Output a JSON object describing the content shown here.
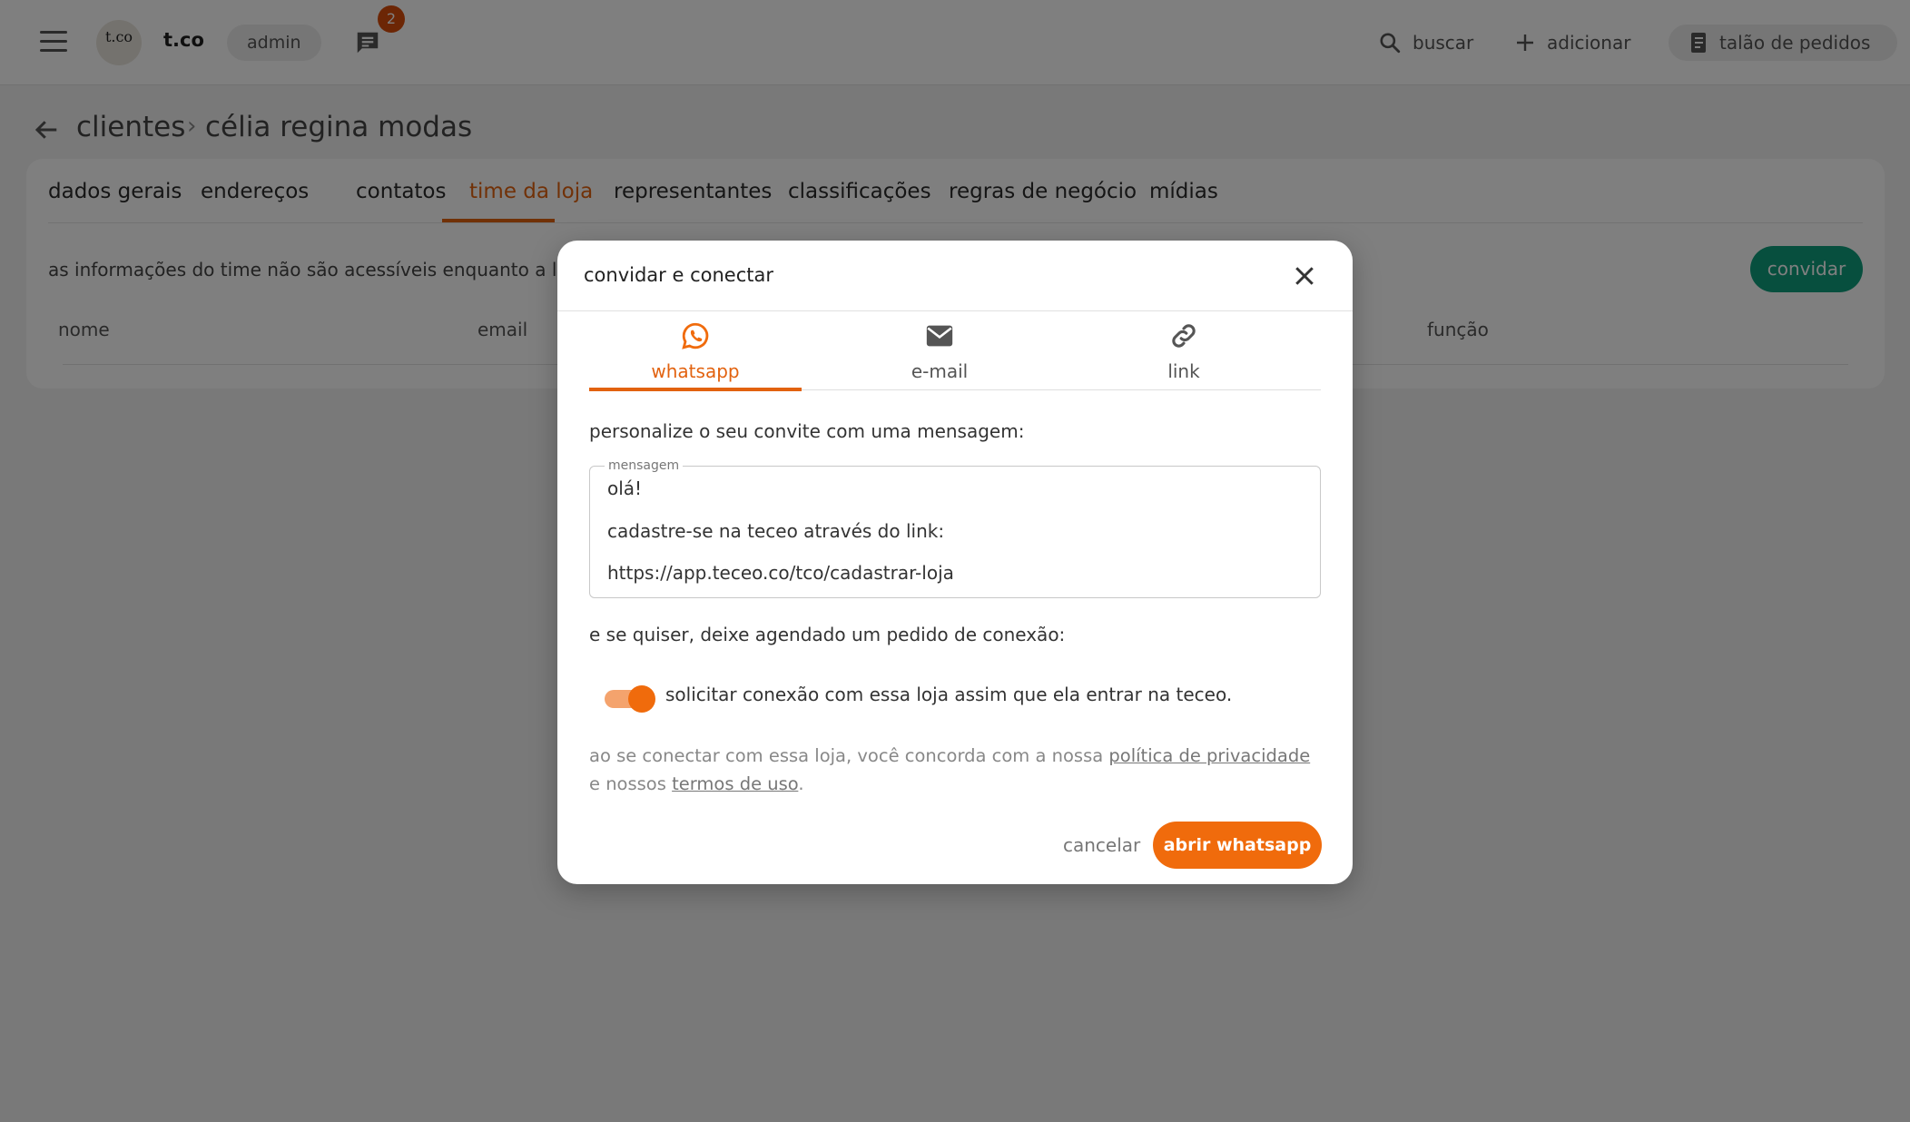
{
  "topbar": {
    "avatar_initials": "t.co",
    "brand": "t.co",
    "role": "admin",
    "notification_count": "2",
    "search_label": "buscar",
    "add_label": "adicionar",
    "orders_label": "talão de pedidos",
    "icons": [
      "menu-icon",
      "chat-icon",
      "search-icon",
      "plus-icon",
      "notebook-icon"
    ]
  },
  "breadcrumb": {
    "parent": "clientes",
    "separator": "›",
    "current": "célia regina modas"
  },
  "tabs": [
    {
      "label": "dados gerais"
    },
    {
      "label": "endereços"
    },
    {
      "label": "contatos"
    },
    {
      "label": "time da loja",
      "active": true
    },
    {
      "label": "representantes"
    },
    {
      "label": "classificações"
    },
    {
      "label": "regras de negócio"
    },
    {
      "label": "mídias"
    }
  ],
  "team": {
    "info": "as informações do time não são acessíveis enquanto a loja n",
    "invite_button": "convidar",
    "columns": [
      "nome",
      "email",
      "função"
    ]
  },
  "modal": {
    "title": "convidar e conectar",
    "tabs": [
      {
        "label": "whatsapp",
        "icon": "whatsapp-icon",
        "active": true
      },
      {
        "label": "e-mail",
        "icon": "mail-icon"
      },
      {
        "label": "link",
        "icon": "link-icon"
      }
    ],
    "prompt": "personalize o seu convite com uma mensagem:",
    "message_label": "mensagem",
    "message_lines": [
      "olá!",
      "cadastre-se na teceo através do link:",
      "https://app.teceo.co/tco/cadastrar-loja"
    ],
    "schedule_prompt": "e se quiser, deixe agendado um pedido de conexão:",
    "toggle_label": "solicitar conexão com essa loja assim que ela entrar na teceo.",
    "toggle_on": true,
    "legal": {
      "part1": "ao se conectar com essa loja, você concorda com a nossa ",
      "privacy_link": "política de privacidade",
      "part2": " e nossos ",
      "terms_link": "termos de uso",
      "part3": "."
    },
    "cancel_label": "cancelar",
    "confirm_label": "abrir whatsapp"
  },
  "colors": {
    "accent": "#f06b0c",
    "accent_text": "#e2620f",
    "success": "#0f9e7c",
    "badge": "#d84c0b"
  }
}
